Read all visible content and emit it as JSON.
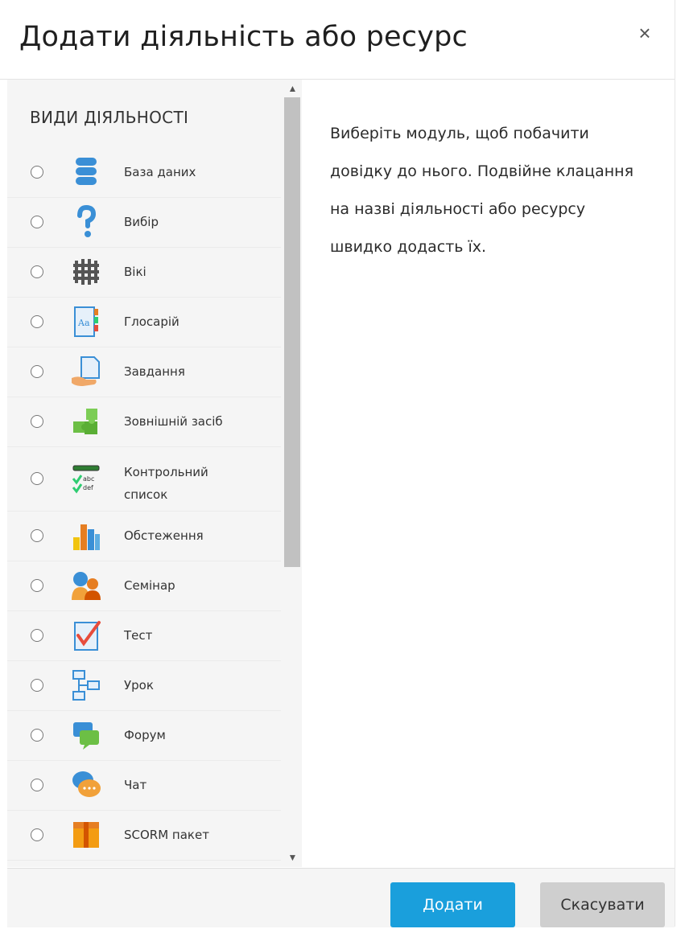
{
  "dialog": {
    "title": "Додати діяльність або ресурс",
    "close_label": "×"
  },
  "activities": {
    "section_title": "ВИДИ ДІЯЛЬНОСТІ",
    "items": [
      {
        "label": "База даних",
        "icon": "database-icon"
      },
      {
        "label": "Вибір",
        "icon": "question-icon"
      },
      {
        "label": "Вікі",
        "icon": "wiki-icon"
      },
      {
        "label": "Глосарій",
        "icon": "glossary-icon"
      },
      {
        "label": "Завдання",
        "icon": "assignment-icon"
      },
      {
        "label": "Зовнішній засіб",
        "icon": "puzzle-icon"
      },
      {
        "label": "Контрольний список",
        "icon": "checklist-icon"
      },
      {
        "label": "Обстеження",
        "icon": "survey-chart-icon"
      },
      {
        "label": "Семінар",
        "icon": "workshop-people-icon"
      },
      {
        "label": "Тест",
        "icon": "quiz-check-icon"
      },
      {
        "label": "Урок",
        "icon": "lesson-flow-icon"
      },
      {
        "label": "Форум",
        "icon": "forum-icon"
      },
      {
        "label": "Чат",
        "icon": "chat-bubble-icon"
      },
      {
        "label": "SCORM пакет",
        "icon": "scorm-package-icon"
      }
    ]
  },
  "help": {
    "text": "Виберіть модуль, щоб побачити довідку до нього. Подвійне клацання на назві діяльності або ресурсу швидко додасть їх."
  },
  "footer": {
    "add_label": "Додати",
    "cancel_label": "Скасувати"
  },
  "colors": {
    "primary_button": "#1a9fdc",
    "secondary_button": "#cfcfcf",
    "pane_background": "#f5f5f5"
  }
}
